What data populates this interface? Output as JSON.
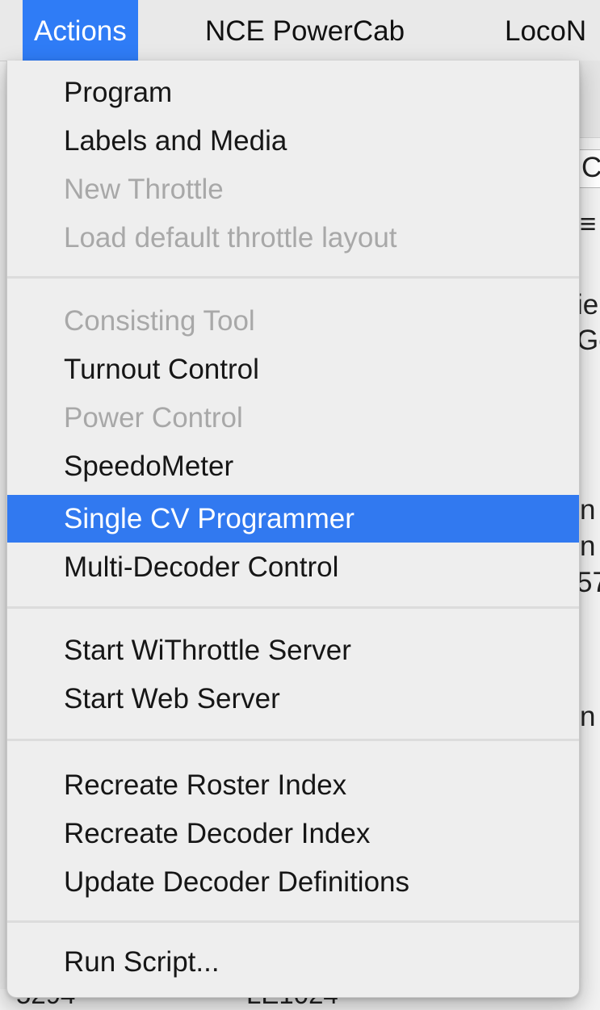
{
  "menubar": {
    "items": [
      {
        "label": "Actions",
        "active": true
      },
      {
        "label": "NCE PowerCab",
        "active": false
      },
      {
        "label": "LocoN",
        "active": false
      }
    ]
  },
  "actions_menu": {
    "groups": [
      [
        {
          "label": "Program",
          "enabled": true
        },
        {
          "label": "Labels and Media",
          "enabled": true
        },
        {
          "label": "New Throttle",
          "enabled": false
        },
        {
          "label": "Load default throttle layout",
          "enabled": false
        }
      ],
      [
        {
          "label": "Consisting Tool",
          "enabled": false
        },
        {
          "label": "Turnout Control",
          "enabled": true
        },
        {
          "label": "Power Control",
          "enabled": false
        },
        {
          "label": "SpeedoMeter",
          "enabled": true
        },
        {
          "label": "Single CV Programmer",
          "enabled": true,
          "highlighted": true
        },
        {
          "label": "Multi-Decoder Control",
          "enabled": true
        }
      ],
      [
        {
          "label": "Start WiThrottle Server",
          "enabled": true
        },
        {
          "label": "Start Web Server",
          "enabled": true
        }
      ],
      [
        {
          "label": "Recreate Roster Index",
          "enabled": true
        },
        {
          "label": "Recreate Decoder Index",
          "enabled": true
        },
        {
          "label": "Update Decoder Definitions",
          "enabled": true
        }
      ],
      [
        {
          "label": "Run Script...",
          "enabled": true
        }
      ]
    ]
  },
  "background": {
    "fragments": [
      "C",
      "≡",
      "ie",
      "Gc",
      "n",
      "n",
      "57",
      "n"
    ],
    "bottom_fragments": [
      "5294",
      "LE1024"
    ]
  }
}
